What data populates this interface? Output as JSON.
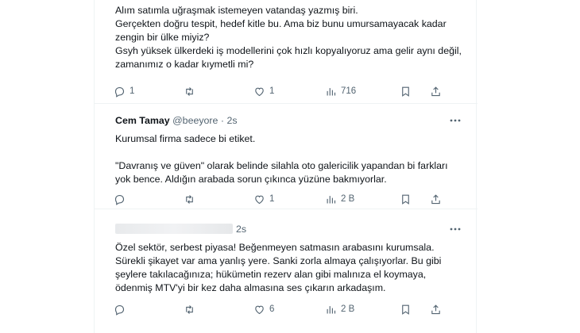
{
  "tweets": [
    {
      "text": "Alım satımla uğraşmak istemeyen vatandaş yazmış biri.\nGerçekten doğru tespit, hedef kitle bu. Ama biz bunu umursamayacak kadar zengin bir ülke miyiz?\nGsyh yüksek ülkerdeki iş modellerini çok hızlı kopyalıyoruz ama gelir aynı değil, zamanımız o kadar kıymetli mi?",
      "replies": "1",
      "retweets": "",
      "likes": "1",
      "views": "716"
    },
    {
      "name": "Cem Tamay",
      "handle": "@beeyore",
      "separator": "·",
      "time": "2s",
      "text": "Kurumsal firma sadece bi etiket.\n\n\"Davranış ve güven\" olarak belinde silahla oto galericilik yapandan bi farkları yok bence. Aldığın arabada sorun çıkınca yüzüne bakmıyorlar.",
      "replies": "",
      "retweets": "",
      "likes": "1",
      "views": "2 B"
    },
    {
      "time": "2s",
      "text": "Özel sektör, serbest piyasa! Beğenmeyen satmasın arabasını kurumsala. Sürekli şikayet var ama yanlış yere. Sanki zorla almaya çalışıyorlar. Bu gibi şeylere takılacağınıza; hükümetin rezerv alan gibi malınıza el koymaya, ödenmiş MTV'yi bir kez daha almasına ses çıkarın arkadaşım.",
      "replies": "",
      "retweets": "",
      "likes": "6",
      "views": "2 B"
    }
  ],
  "colors": {
    "text": "#0f1419",
    "muted": "#536471",
    "border": "#eff3f4"
  },
  "icons": [
    "reply-icon",
    "retweet-icon",
    "like-icon",
    "views-icon",
    "bookmark-icon",
    "share-icon",
    "more-icon"
  ]
}
